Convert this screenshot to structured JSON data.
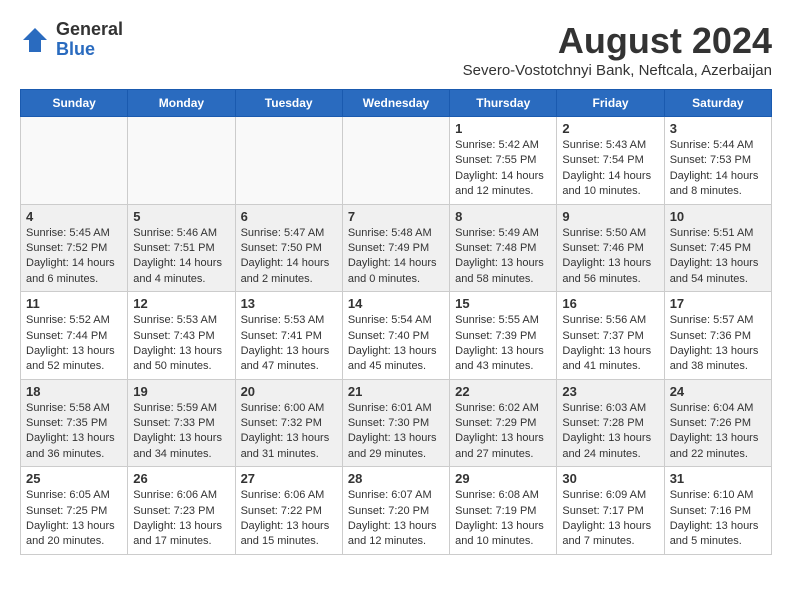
{
  "logo": {
    "general": "General",
    "blue": "Blue"
  },
  "title": "August 2024",
  "subtitle": "Severo-Vostotchnyi Bank, Neftcala, Azerbaijan",
  "headers": [
    "Sunday",
    "Monday",
    "Tuesday",
    "Wednesday",
    "Thursday",
    "Friday",
    "Saturday"
  ],
  "weeks": [
    [
      {
        "day": "",
        "content": ""
      },
      {
        "day": "",
        "content": ""
      },
      {
        "day": "",
        "content": ""
      },
      {
        "day": "",
        "content": ""
      },
      {
        "day": "1",
        "content": "Sunrise: 5:42 AM\nSunset: 7:55 PM\nDaylight: 14 hours\nand 12 minutes."
      },
      {
        "day": "2",
        "content": "Sunrise: 5:43 AM\nSunset: 7:54 PM\nDaylight: 14 hours\nand 10 minutes."
      },
      {
        "day": "3",
        "content": "Sunrise: 5:44 AM\nSunset: 7:53 PM\nDaylight: 14 hours\nand 8 minutes."
      }
    ],
    [
      {
        "day": "4",
        "content": "Sunrise: 5:45 AM\nSunset: 7:52 PM\nDaylight: 14 hours\nand 6 minutes."
      },
      {
        "day": "5",
        "content": "Sunrise: 5:46 AM\nSunset: 7:51 PM\nDaylight: 14 hours\nand 4 minutes."
      },
      {
        "day": "6",
        "content": "Sunrise: 5:47 AM\nSunset: 7:50 PM\nDaylight: 14 hours\nand 2 minutes."
      },
      {
        "day": "7",
        "content": "Sunrise: 5:48 AM\nSunset: 7:49 PM\nDaylight: 14 hours\nand 0 minutes."
      },
      {
        "day": "8",
        "content": "Sunrise: 5:49 AM\nSunset: 7:48 PM\nDaylight: 13 hours\nand 58 minutes."
      },
      {
        "day": "9",
        "content": "Sunrise: 5:50 AM\nSunset: 7:46 PM\nDaylight: 13 hours\nand 56 minutes."
      },
      {
        "day": "10",
        "content": "Sunrise: 5:51 AM\nSunset: 7:45 PM\nDaylight: 13 hours\nand 54 minutes."
      }
    ],
    [
      {
        "day": "11",
        "content": "Sunrise: 5:52 AM\nSunset: 7:44 PM\nDaylight: 13 hours\nand 52 minutes."
      },
      {
        "day": "12",
        "content": "Sunrise: 5:53 AM\nSunset: 7:43 PM\nDaylight: 13 hours\nand 50 minutes."
      },
      {
        "day": "13",
        "content": "Sunrise: 5:53 AM\nSunset: 7:41 PM\nDaylight: 13 hours\nand 47 minutes."
      },
      {
        "day": "14",
        "content": "Sunrise: 5:54 AM\nSunset: 7:40 PM\nDaylight: 13 hours\nand 45 minutes."
      },
      {
        "day": "15",
        "content": "Sunrise: 5:55 AM\nSunset: 7:39 PM\nDaylight: 13 hours\nand 43 minutes."
      },
      {
        "day": "16",
        "content": "Sunrise: 5:56 AM\nSunset: 7:37 PM\nDaylight: 13 hours\nand 41 minutes."
      },
      {
        "day": "17",
        "content": "Sunrise: 5:57 AM\nSunset: 7:36 PM\nDaylight: 13 hours\nand 38 minutes."
      }
    ],
    [
      {
        "day": "18",
        "content": "Sunrise: 5:58 AM\nSunset: 7:35 PM\nDaylight: 13 hours\nand 36 minutes."
      },
      {
        "day": "19",
        "content": "Sunrise: 5:59 AM\nSunset: 7:33 PM\nDaylight: 13 hours\nand 34 minutes."
      },
      {
        "day": "20",
        "content": "Sunrise: 6:00 AM\nSunset: 7:32 PM\nDaylight: 13 hours\nand 31 minutes."
      },
      {
        "day": "21",
        "content": "Sunrise: 6:01 AM\nSunset: 7:30 PM\nDaylight: 13 hours\nand 29 minutes."
      },
      {
        "day": "22",
        "content": "Sunrise: 6:02 AM\nSunset: 7:29 PM\nDaylight: 13 hours\nand 27 minutes."
      },
      {
        "day": "23",
        "content": "Sunrise: 6:03 AM\nSunset: 7:28 PM\nDaylight: 13 hours\nand 24 minutes."
      },
      {
        "day": "24",
        "content": "Sunrise: 6:04 AM\nSunset: 7:26 PM\nDaylight: 13 hours\nand 22 minutes."
      }
    ],
    [
      {
        "day": "25",
        "content": "Sunrise: 6:05 AM\nSunset: 7:25 PM\nDaylight: 13 hours\nand 20 minutes."
      },
      {
        "day": "26",
        "content": "Sunrise: 6:06 AM\nSunset: 7:23 PM\nDaylight: 13 hours\nand 17 minutes."
      },
      {
        "day": "27",
        "content": "Sunrise: 6:06 AM\nSunset: 7:22 PM\nDaylight: 13 hours\nand 15 minutes."
      },
      {
        "day": "28",
        "content": "Sunrise: 6:07 AM\nSunset: 7:20 PM\nDaylight: 13 hours\nand 12 minutes."
      },
      {
        "day": "29",
        "content": "Sunrise: 6:08 AM\nSunset: 7:19 PM\nDaylight: 13 hours\nand 10 minutes."
      },
      {
        "day": "30",
        "content": "Sunrise: 6:09 AM\nSunset: 7:17 PM\nDaylight: 13 hours\nand 7 minutes."
      },
      {
        "day": "31",
        "content": "Sunrise: 6:10 AM\nSunset: 7:16 PM\nDaylight: 13 hours\nand 5 minutes."
      }
    ]
  ]
}
